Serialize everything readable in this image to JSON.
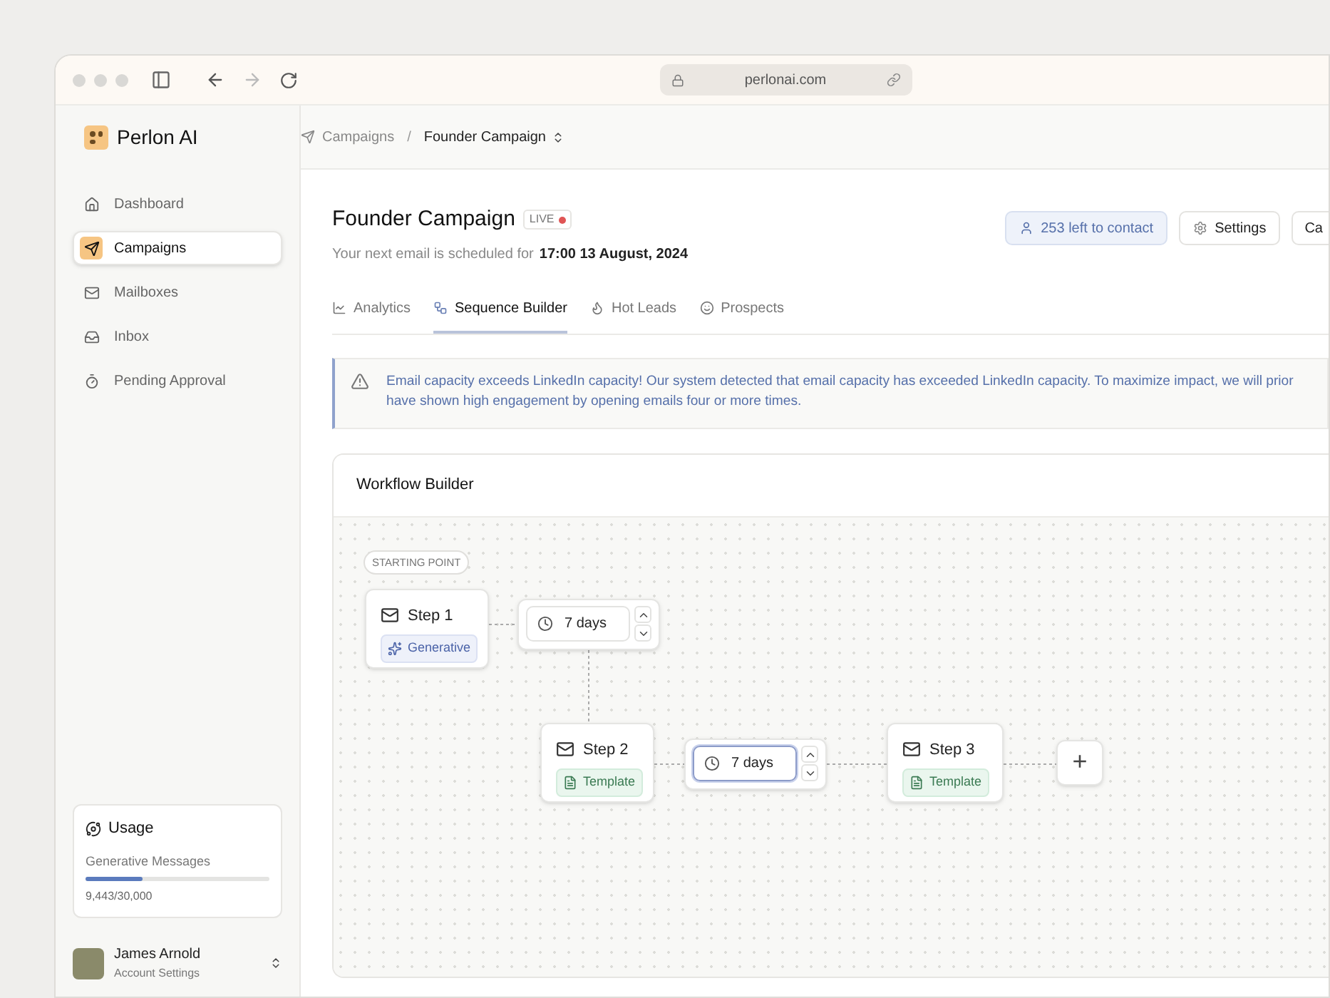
{
  "browser": {
    "url": "perlonai.com"
  },
  "app": {
    "name": "Perlon AI"
  },
  "breadcrumb": {
    "parent": "Campaigns",
    "separator": "/",
    "current": "Founder Campaign"
  },
  "sidebar": {
    "items": [
      {
        "label": "Dashboard",
        "selected": false
      },
      {
        "label": "Campaigns",
        "selected": true
      },
      {
        "label": "Mailboxes",
        "selected": false
      },
      {
        "label": "Inbox",
        "selected": false
      },
      {
        "label": "Pending Approval",
        "selected": false
      }
    ],
    "usage": {
      "title": "Usage",
      "label": "Generative Messages",
      "level": 0.31,
      "reading": "9,443/30,000"
    },
    "user": {
      "name": "James Arnold",
      "subtitle": "Account Settings"
    }
  },
  "campaign": {
    "title": "Founder Campaign",
    "status": "LIVE",
    "schedule_prefix": "Your next email is scheduled for",
    "schedule_time": "17:00 13 August, 2024",
    "contacts": "253 left to contact",
    "settings": "Settings",
    "button_3": "Ca"
  },
  "tabs": [
    {
      "label": "Analytics",
      "selected": false
    },
    {
      "label": "Sequence Builder",
      "selected": true
    },
    {
      "label": "Hot Leads",
      "selected": false
    },
    {
      "label": "Prospects",
      "selected": false
    }
  ],
  "alert": {
    "lines": [
      "Email capacity exceeds LinkedIn capacity! Our system detected that email capacity has exceeded LinkedIn capacity. To maximize impact, we will prior",
      "have shown high engagement by opening emails four or more times."
    ]
  },
  "workflow": {
    "title": "Workflow Builder",
    "start_label": "STARTING POINT",
    "nodes": [
      {
        "kind": "step",
        "label": "Step 1",
        "badge": {
          "label": "Generative",
          "kind": "generative"
        }
      },
      {
        "kind": "delay",
        "value": "7 days",
        "focused": false
      },
      {
        "kind": "step",
        "label": "Step 2",
        "badge": {
          "label": "Template",
          "kind": "template"
        }
      },
      {
        "kind": "delay",
        "value": "7 days",
        "focused": true
      },
      {
        "kind": "step",
        "label": "Step 3",
        "badge": {
          "label": "Template",
          "kind": "template"
        }
      },
      {
        "kind": "add",
        "symbol": "+"
      }
    ]
  }
}
